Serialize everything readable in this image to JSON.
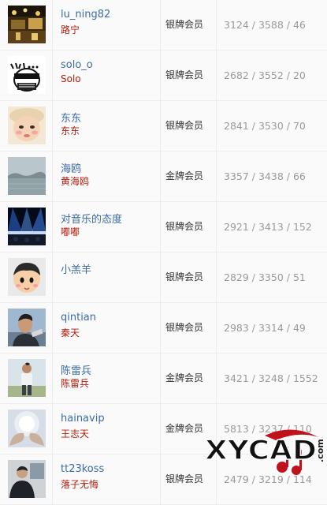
{
  "members": [
    {
      "username": "lu_ning82",
      "real_name": "路宁",
      "level": "银牌会员",
      "stats": "3124 / 3588 / 46",
      "avatar_icon": "bar-interior-photo-icon"
    },
    {
      "username": "solo_o",
      "real_name": "Solo",
      "level": "银牌会员",
      "stats": "2682 / 3552 / 20",
      "avatar_icon": "cartoon-sketch-avatar-icon"
    },
    {
      "username": "东东",
      "real_name": "东东",
      "level": "银牌会员",
      "stats": "2841 / 3530 / 70",
      "avatar_icon": "baby-photo-icon"
    },
    {
      "username": "海鸥",
      "real_name": "黄海鸥",
      "level": "金牌会员",
      "stats": "3357 / 3438 / 66",
      "avatar_icon": "sea-landscape-photo-icon"
    },
    {
      "username": "对音乐的态度",
      "real_name": "嘟嘟",
      "level": "银牌会员",
      "stats": "2921 / 3413 / 152",
      "avatar_icon": "concert-stage-photo-icon"
    },
    {
      "username": "小羔羊",
      "real_name": "",
      "level": "银牌会员",
      "stats": "2829 / 3350 / 51",
      "avatar_icon": "cartoon-boy-avatar-icon"
    },
    {
      "username": "qintian",
      "real_name": "秦天",
      "level": "银牌会员",
      "stats": "2983 / 3314 / 49",
      "avatar_icon": "man-photo-icon"
    },
    {
      "username": "陈雷兵",
      "real_name": "陈雷兵",
      "level": "金牌会员",
      "stats": "3421 / 3248 / 1552",
      "avatar_icon": "man-standing-outdoor-photo-icon"
    },
    {
      "username": "hainavip",
      "real_name": "王志天",
      "level": "金牌会员",
      "stats": "5813 / 3237 / 110",
      "avatar_icon": "hands-light-photo-icon"
    },
    {
      "username": "tt23koss",
      "real_name": "落子无悔",
      "level": "银牌会员",
      "stats": "2479 / 3219 / 114",
      "avatar_icon": "man-office-photo-icon"
    }
  ],
  "watermark": {
    "logo_text": "XYCAD",
    "domain_text": ".com",
    "icon": "xycad-watermark-logo"
  }
}
